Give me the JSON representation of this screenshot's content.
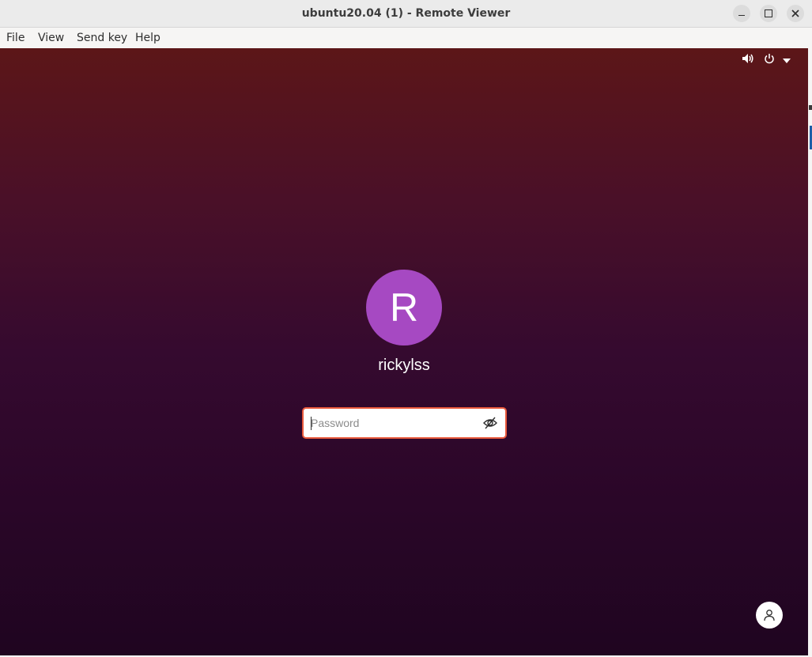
{
  "window": {
    "title": "ubuntu20.04 (1) - Remote Viewer",
    "controls": [
      "minimize-icon",
      "maximize-icon",
      "close-icon"
    ]
  },
  "menubar": {
    "items": [
      "File",
      "View",
      "Send key",
      "Help"
    ]
  },
  "login": {
    "avatar_letter": "R",
    "avatar_color": "#a649c2",
    "username": "rickylss",
    "password_placeholder": "Password",
    "password_value": "",
    "input_border_color": "#e9593c"
  },
  "top_bar_icons": [
    "volume-icon",
    "power-icon",
    "chevron-down-icon"
  ],
  "bottom_right_icon": "accessibility-user-icon"
}
